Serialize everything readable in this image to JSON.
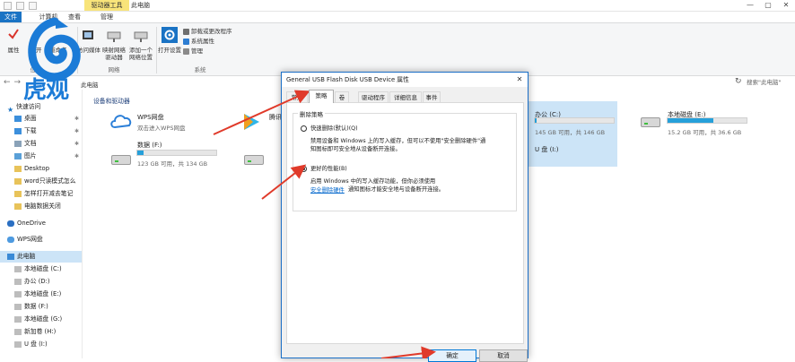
{
  "window": {
    "context_tab": "驱动器工具",
    "title": "此电脑",
    "controls": [
      "—",
      "▢",
      "✕"
    ]
  },
  "ribbon_tabs": {
    "file": "文件",
    "computer": "计算机",
    "view": "查看",
    "manage": "管理"
  },
  "ribbon": {
    "properties": "属性",
    "open": "打开",
    "rename": "重命名",
    "access_media": "访问媒体",
    "map_drive": "映射网络驱动器",
    "add_location": "添加一个网络位置",
    "open_settings": "打开设置",
    "uninstall": "卸载或更改程序",
    "sys_props": "系统属性",
    "manage": "管理",
    "group_location": "位置",
    "group_network": "网络",
    "group_system": "系统"
  },
  "address": {
    "path": "此电脑",
    "search_placeholder": "搜索\"此电脑\""
  },
  "logo": {
    "text": "虎观"
  },
  "nav": {
    "quick_access": "快速访问",
    "items": [
      {
        "label": "桌面",
        "pinned": true
      },
      {
        "label": "下载",
        "pinned": true
      },
      {
        "label": "文档",
        "pinned": true
      },
      {
        "label": "图片",
        "pinned": true
      },
      {
        "label": "Desktop",
        "pinned": false
      },
      {
        "label": "word只读模式怎么",
        "pinned": false
      },
      {
        "label": "怎样打开减去笔记",
        "pinned": false
      },
      {
        "label": "电脑数据关闭",
        "pinned": false
      }
    ],
    "onedrive": "OneDrive",
    "wps": "WPS网盘",
    "this_pc": "此电脑",
    "drives": [
      "本地磁盘 (C:)",
      "办公 (D:)",
      "本地磁盘 (E:)",
      "数据 (F:)",
      "本地磁盘 (G:)",
      "新加卷 (H:)",
      "U 盘 (I:)"
    ]
  },
  "content": {
    "section_devices": "设备和驱动器",
    "wps_title": "WPS网盘",
    "wps_sub": "双击进入WPS网盘",
    "tencent_title": "腾讯",
    "data_drive": {
      "name": "数据 (F:)",
      "space": "123 GB 可用，共 134 GB",
      "used_fraction": 0.08
    },
    "office_drive": {
      "name": "办公 (C:)",
      "space": "145 GB 可用，共 146 GB",
      "used_fraction": 0.02
    },
    "local_e": {
      "name": "本地磁盘 (E:)",
      "space": "15.2 GB 可用，共 36.6 GB",
      "used_fraction": 0.58
    },
    "usb_drive": {
      "name": "U 盘 (I:)"
    }
  },
  "dialog": {
    "title": "General USB Flash Disk USB Device 属性",
    "close": "✕",
    "tabs": [
      "常规",
      "策略",
      "卷",
      "驱动程序",
      "详细信息",
      "事件"
    ],
    "active_tab": 1,
    "group_title": "删除策略",
    "option1_label": "快速删除(默认)(Q)",
    "option1_desc1": "禁用设备和 Windows 上的写入缓存，但可以不使用\"安全删除硬件\"通",
    "option1_desc2": "知图标即可安全地从设备断开连接。",
    "option2_label": "更好的性能(B)",
    "option2_desc1": "启用 Windows 中的写入缓存功能，但你必须使用",
    "option2_link": "安全删除硬件",
    "option2_desc2": "通知图标才能安全地与设备断开连接。",
    "selected_option": 2,
    "ok": "确定",
    "cancel": "取消"
  },
  "colors": {
    "accent": "#1a73c4",
    "annotation_arrow": "#e03a2a",
    "drive_bar": "#26a0da"
  }
}
